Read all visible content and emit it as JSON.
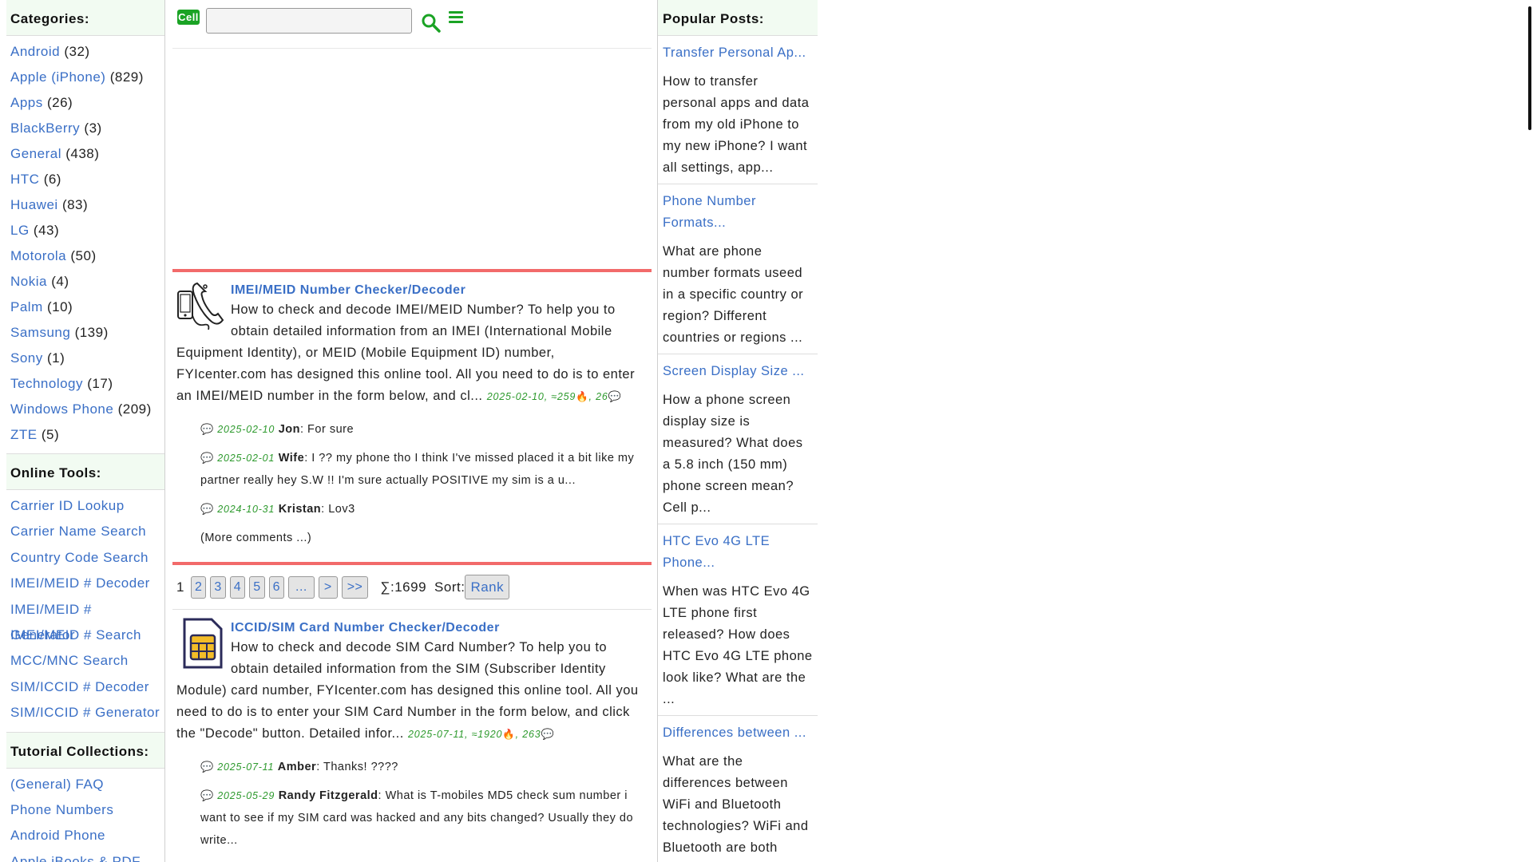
{
  "sidebar": {
    "categories_title": "Categories:",
    "categories": [
      {
        "label": "Android",
        "count": "(32)"
      },
      {
        "label": "Apple (iPhone)",
        "count": "(829)"
      },
      {
        "label": "Apps",
        "count": "(26)"
      },
      {
        "label": "BlackBerry",
        "count": "(3)"
      },
      {
        "label": "General",
        "count": "(438)"
      },
      {
        "label": "HTC",
        "count": "(6)"
      },
      {
        "label": "Huawei",
        "count": "(83)"
      },
      {
        "label": "LG",
        "count": "(43)"
      },
      {
        "label": "Motorola",
        "count": "(50)"
      },
      {
        "label": "Nokia",
        "count": "(4)"
      },
      {
        "label": "Palm",
        "count": "(10)"
      },
      {
        "label": "Samsung",
        "count": "(139)"
      },
      {
        "label": "Sony",
        "count": "(1)"
      },
      {
        "label": "Technology",
        "count": "(17)"
      },
      {
        "label": "Windows Phone",
        "count": "(209)"
      },
      {
        "label": "ZTE",
        "count": "(5)"
      }
    ],
    "tools_title": "Online Tools:",
    "tools": [
      "Carrier ID Lookup",
      "Carrier Name Search",
      "Country Code Search",
      "IMEI/MEID # Decoder",
      "IMEI/MEID # Generator",
      "IMEI/MEID # Search",
      "MCC/MNC Search",
      "SIM/ICCID # Decoder",
      "SIM/ICCID # Generator"
    ],
    "tutorials_title": "Tutorial Collections:",
    "tutorials": [
      "(General) FAQ",
      "Phone Numbers",
      "Android Phone",
      "Apple iBooks & PDF"
    ]
  },
  "header": {
    "logo_text": "Cell",
    "search_value": ""
  },
  "articles": [
    {
      "title": "IMEI/MEID Number Checker/Decoder",
      "desc": "How to check and decode IMEI/MEID Number? To help you to obtain detailed information from an IMEI (International Mobile Equipment Identity), or MEID (Mobile Equipment ID) number, FYIcenter.com has designed this online tool. All you need to do is to enter an IMEI/MEID number in the form below, and cl...",
      "date": "2025-02-10",
      "views": "≈259",
      "comments_count": "26",
      "comments": [
        {
          "date": "2025-02-10",
          "who": "Jon",
          "text": ": For sure"
        },
        {
          "date": "2025-02-01",
          "who": "Wife",
          "text": ": I ?? my phone tho I think I've missed placed it a bit like my partner really hey S.W !! I'm sure actually POSITIVE my sim is a u..."
        },
        {
          "date": "2024-10-31",
          "who": "Kristan",
          "text": ": Lov3"
        }
      ],
      "more": "(More comments ...)"
    },
    {
      "title": "ICCID/SIM Card Number Checker/Decoder",
      "desc": "How to check and decode SIM Card Number? To help you to obtain detailed information from the SIM (Subscriber Identity Module) card number, FYIcenter.com has designed this online tool. All you need to do is to enter your SIM Card Number in the form below, and click the \"Decode\" button. Detailed infor...",
      "date": "2025-07-11",
      "views": "≈1920",
      "comments_count": "263",
      "comments": [
        {
          "date": "2025-07-11",
          "who": "Amber",
          "text": ": Thanks! ????"
        },
        {
          "date": "2025-05-29",
          "who": "Randy Fitzgerald",
          "text": ": What is T-mobiles MD5 check sum number i want to see if my SIM card was hacked and any bits changed? Usually they do write..."
        }
      ]
    }
  ],
  "pager": {
    "current": "1",
    "pages": [
      "2",
      "3",
      "4",
      "5",
      "6",
      "...",
      ">",
      ">>"
    ],
    "total": "∑:1699",
    "sort_label": "Sort:",
    "sort_button": "Rank"
  },
  "popular": {
    "title": "Popular Posts:",
    "posts": [
      {
        "title": "Transfer Personal Ap...",
        "desc": "How to transfer personal apps and data from my old iPhone to my new iPhone? I want all settings, app..."
      },
      {
        "title": "Phone Number Formats...",
        "desc": "What are phone number formats useed in a specific country or region? Different countries or regions ..."
      },
      {
        "title": "Screen Display Size ...",
        "desc": "How a phone screen display size is measured? What does a 5.8 inch (150 mm) phone screen mean? Cell p..."
      },
      {
        "title": "HTC Evo 4G LTE Phone...",
        "desc": "When was HTC Evo 4G LTE phone first released? How does HTC Evo 4G LTE phone look like? What are the ..."
      },
      {
        "title": "Differences between ...",
        "desc": "What are the differences between WiFi and Bluetooth technologies? WiFi and Bluetooth are both"
      }
    ]
  },
  "colors": {
    "link": "#3a6fc6",
    "accent_green": "#1aa324",
    "rule_red": "#f26a6a",
    "meta_green": "#2e9a2e"
  }
}
